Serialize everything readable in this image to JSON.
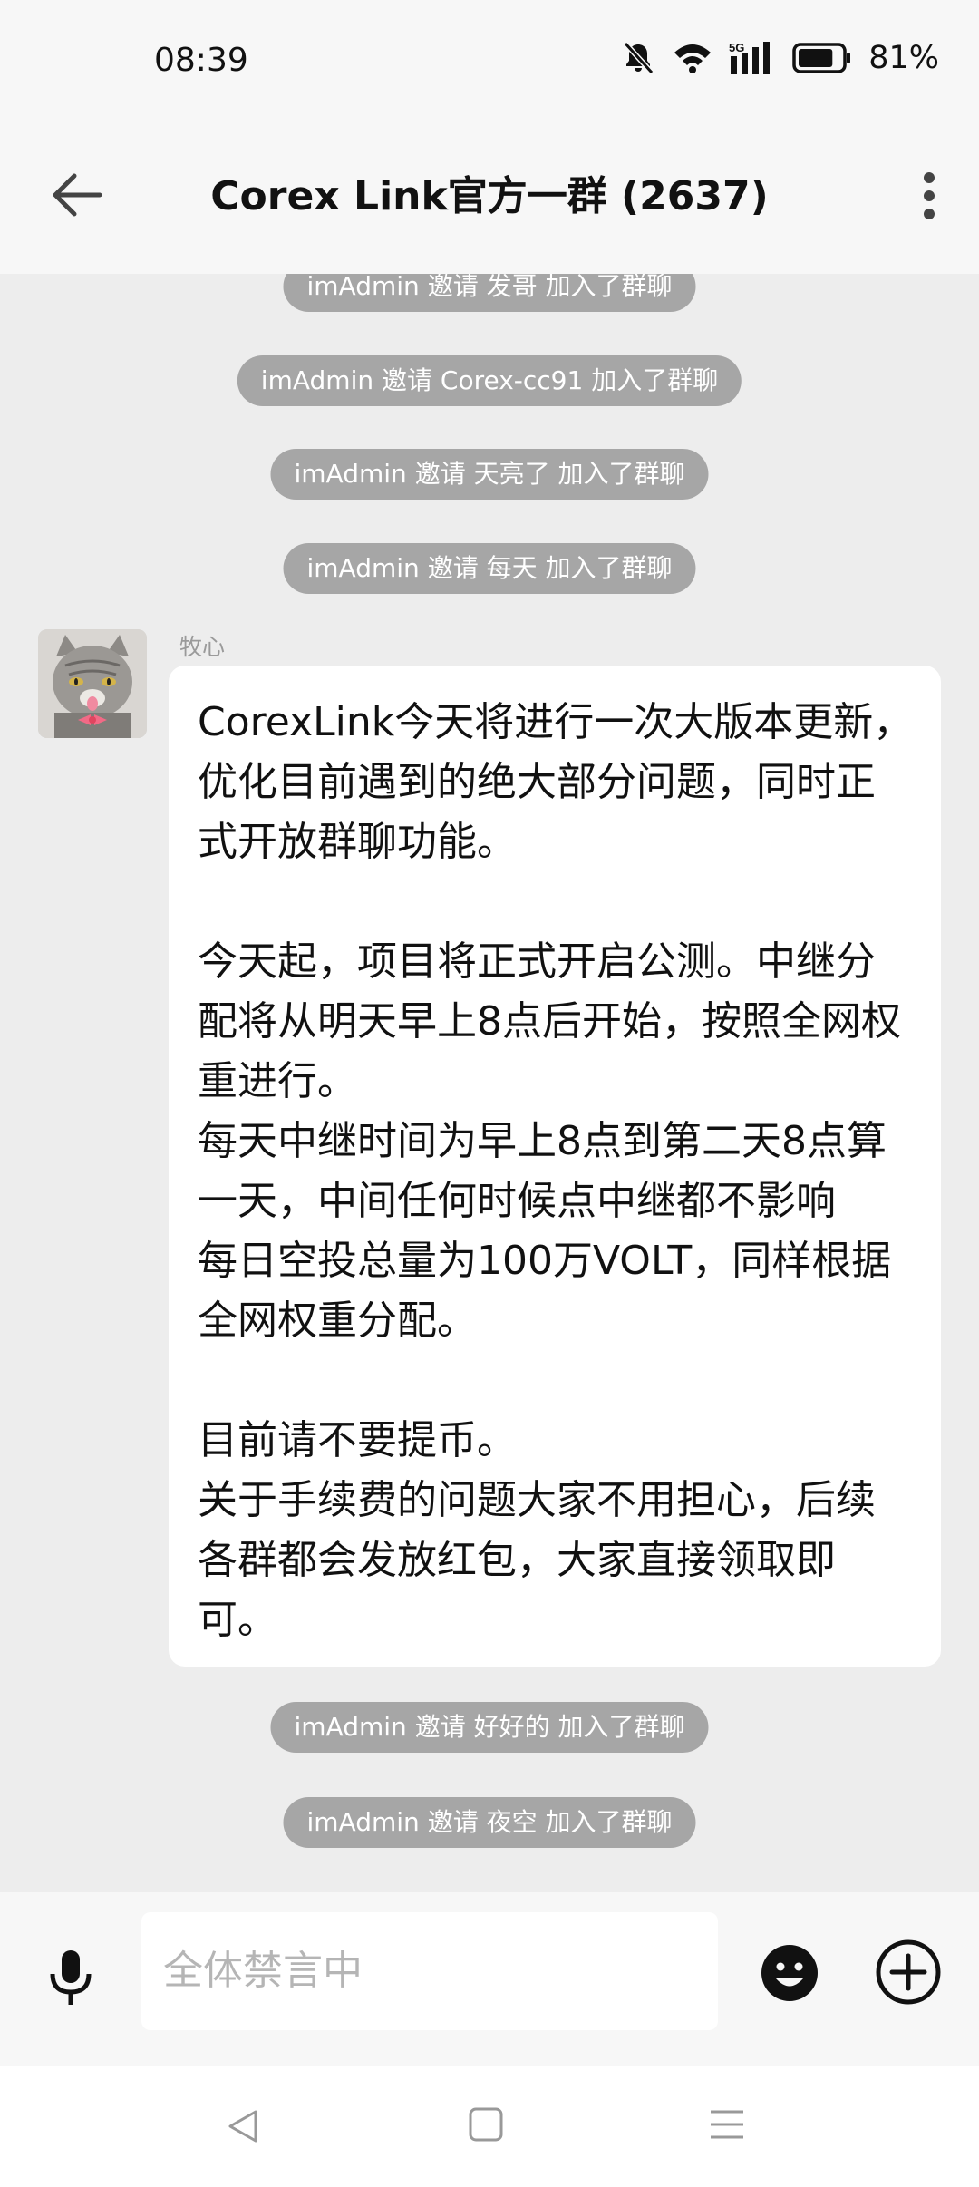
{
  "status_bar": {
    "time": "08:39",
    "network": "5G",
    "battery_percent": "81%",
    "battery_level": 0.81,
    "icons": [
      "mute-bell-icon",
      "wifi-icon",
      "signal-icon",
      "battery-icon"
    ]
  },
  "header": {
    "title": "Corex Link官方一群 (2637)",
    "back_icon": "arrow-left-icon",
    "more_icon": "more-vertical-icon"
  },
  "chat": {
    "system_top": [
      "imAdmin 邀请 发哥 加入了群聊",
      "imAdmin 邀请 Corex-cc91 加入了群聊",
      "imAdmin 邀请 天亮了 加入了群聊",
      "imAdmin 邀请 每天 加入了群聊"
    ],
    "message": {
      "sender": "牧心",
      "avatar_icon": "cat-avatar",
      "paragraph1": "CorexLink今天将进行一次大版本更新，优化目前遇到的绝大部分问题，同时正式开放群聊功能。",
      "paragraph2": "今天起，项目将正式开启公测。中继分配将从明天早上8点后开始，按照全网权重进行。",
      "paragraph3": "每天中继时间为早上8点到第二天8点算一天，中间任何时候点中继都不影响",
      "paragraph4": "每日空投总量为100万VOLT，同样根据全网权重分配。",
      "paragraph5": "目前请不要提币。",
      "paragraph6": "关于手续费的问题大家不用担心，后续各群都会发放红包，大家直接领取即可。"
    },
    "system_bottom": [
      "imAdmin 邀请 好好的 加入了群聊",
      "imAdmin 邀请 夜空 加入了群聊"
    ]
  },
  "input_bar": {
    "placeholder": "全体禁言中",
    "icons": [
      "microphone-icon",
      "emoji-icon",
      "plus-circle-icon"
    ]
  },
  "nav_bar": {
    "icons": [
      "nav-back-icon",
      "nav-home-icon",
      "nav-menu-icon"
    ]
  }
}
